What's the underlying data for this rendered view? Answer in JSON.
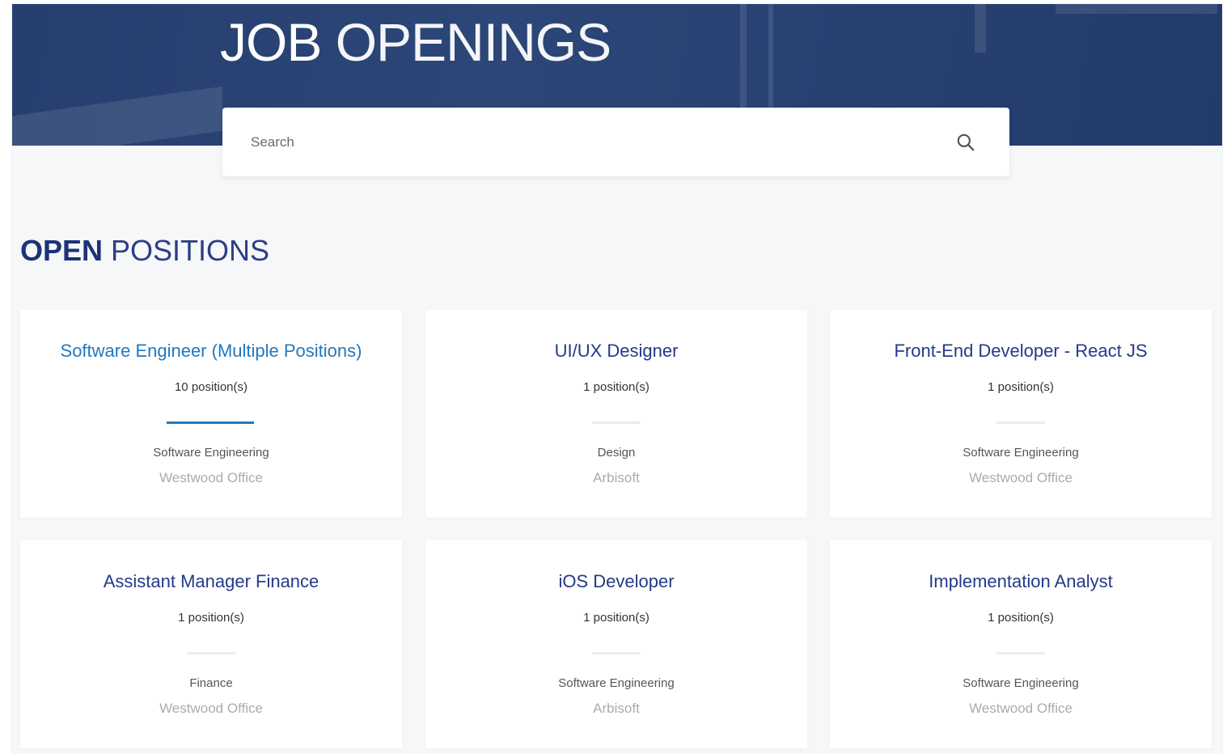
{
  "header": {
    "title_part1": "JOB",
    "title_part2": " OPENINGS"
  },
  "search": {
    "placeholder": "Search",
    "icon": "search-icon"
  },
  "section": {
    "title_part1": "OPEN",
    "title_part2": " POSITIONS"
  },
  "colors": {
    "brand_navy": "#243a87",
    "active_blue": "#2378bd",
    "hero_bg": "#2b4677"
  },
  "jobs": [
    {
      "title": "Software Engineer (Multiple Positions)",
      "count": "10 position(s)",
      "department": "Software Engineering",
      "location": "Westwood Office",
      "active": true
    },
    {
      "title": "UI/UX Designer",
      "count": "1 position(s)",
      "department": "Design",
      "location": "Arbisoft",
      "active": false
    },
    {
      "title": "Front-End Developer - React JS",
      "count": "1 position(s)",
      "department": "Software Engineering",
      "location": "Westwood Office",
      "active": false
    },
    {
      "title": "Assistant Manager Finance",
      "count": "1 position(s)",
      "department": "Finance",
      "location": "Westwood Office",
      "active": false
    },
    {
      "title": "iOS Developer",
      "count": "1 position(s)",
      "department": "Software Engineering",
      "location": "Arbisoft",
      "active": false
    },
    {
      "title": "Implementation Analyst",
      "count": "1 position(s)",
      "department": "Software Engineering",
      "location": "Westwood Office",
      "active": false
    }
  ]
}
